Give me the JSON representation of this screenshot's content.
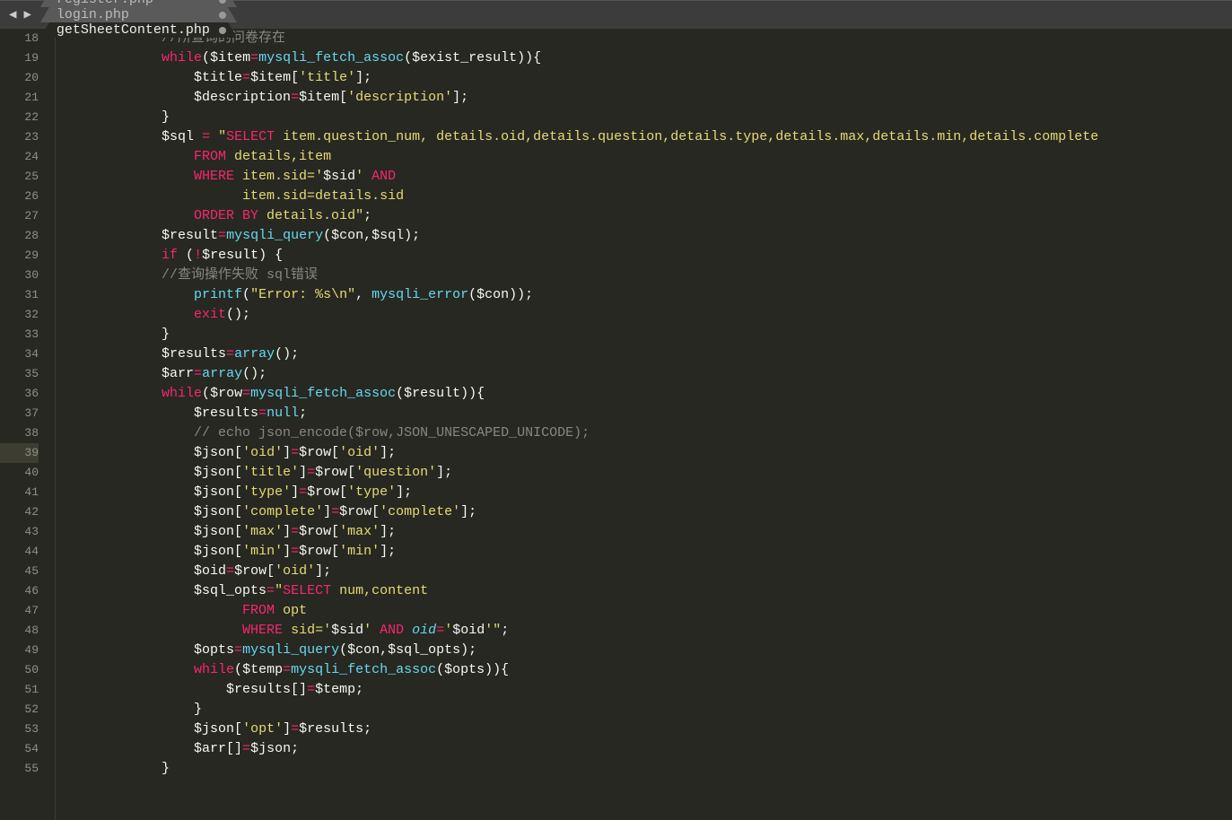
{
  "tabs": [
    {
      "label": "register.php",
      "dirty": true,
      "active": false
    },
    {
      "label": "login.php",
      "dirty": true,
      "active": false
    },
    {
      "label": "getSheetContent.php",
      "dirty": true,
      "active": true
    }
  ],
  "line_start": 18,
  "line_end": 55,
  "highlighted_line": 39,
  "code_lines": [
    {
      "n": 18,
      "tokens": [
        [
          "pn",
          "            "
        ],
        [
          "cmt",
          "//所查询的问卷存在"
        ]
      ]
    },
    {
      "n": 19,
      "tokens": [
        [
          "pn",
          "            "
        ],
        [
          "kw",
          "while"
        ],
        [
          "pn",
          "("
        ],
        [
          "var",
          "$item"
        ],
        [
          "op",
          "="
        ],
        [
          "fn",
          "mysqli_fetch_assoc"
        ],
        [
          "pn",
          "("
        ],
        [
          "var",
          "$exist_result"
        ],
        [
          "pn",
          ")){"
        ]
      ]
    },
    {
      "n": 20,
      "tokens": [
        [
          "pn",
          "                "
        ],
        [
          "var",
          "$title"
        ],
        [
          "op",
          "="
        ],
        [
          "var",
          "$item"
        ],
        [
          "pn",
          "["
        ],
        [
          "str",
          "'title'"
        ],
        [
          "pn",
          "];"
        ]
      ]
    },
    {
      "n": 21,
      "tokens": [
        [
          "pn",
          "                "
        ],
        [
          "var",
          "$description"
        ],
        [
          "op",
          "="
        ],
        [
          "var",
          "$item"
        ],
        [
          "pn",
          "["
        ],
        [
          "str",
          "'description'"
        ],
        [
          "pn",
          "];"
        ]
      ]
    },
    {
      "n": 22,
      "tokens": [
        [
          "pn",
          "            }"
        ]
      ]
    },
    {
      "n": 23,
      "tokens": [
        [
          "pn",
          "            "
        ],
        [
          "var",
          "$sql"
        ],
        [
          "pn",
          " "
        ],
        [
          "op",
          "="
        ],
        [
          "pn",
          " "
        ],
        [
          "str",
          "\""
        ],
        [
          "kw",
          "SELECT"
        ],
        [
          "str",
          " item.question_num, details.oid,details.question,details.type,details.max,details.min,details.complete"
        ]
      ]
    },
    {
      "n": 24,
      "tokens": [
        [
          "pn",
          "                "
        ],
        [
          "kw",
          "FROM"
        ],
        [
          "str",
          " details,item"
        ]
      ]
    },
    {
      "n": 25,
      "tokens": [
        [
          "pn",
          "                "
        ],
        [
          "kw",
          "WHERE"
        ],
        [
          "str",
          " item.sid="
        ],
        [
          "str",
          "'"
        ],
        [
          "var",
          "$sid"
        ],
        [
          "str",
          "'"
        ],
        [
          "str",
          " "
        ],
        [
          "kw",
          "AND"
        ]
      ]
    },
    {
      "n": 26,
      "tokens": [
        [
          "pn",
          "                      "
        ],
        [
          "str",
          "item.sid=details.sid"
        ]
      ]
    },
    {
      "n": 27,
      "tokens": [
        [
          "pn",
          "                "
        ],
        [
          "kw",
          "ORDER BY"
        ],
        [
          "str",
          " details.oid\""
        ],
        [
          "pn",
          ";"
        ]
      ]
    },
    {
      "n": 28,
      "tokens": [
        [
          "pn",
          "            "
        ],
        [
          "var",
          "$result"
        ],
        [
          "op",
          "="
        ],
        [
          "fn",
          "mysqli_query"
        ],
        [
          "pn",
          "("
        ],
        [
          "var",
          "$con"
        ],
        [
          "pn",
          ","
        ],
        [
          "var",
          "$sql"
        ],
        [
          "pn",
          ");"
        ]
      ]
    },
    {
      "n": 29,
      "tokens": [
        [
          "pn",
          "            "
        ],
        [
          "kw",
          "if"
        ],
        [
          "pn",
          " ("
        ],
        [
          "op",
          "!"
        ],
        [
          "var",
          "$result"
        ],
        [
          "pn",
          ") {"
        ]
      ]
    },
    {
      "n": 30,
      "tokens": [
        [
          "pn",
          "            "
        ],
        [
          "cmt",
          "//查询操作失败 sql错误"
        ]
      ]
    },
    {
      "n": 31,
      "tokens": [
        [
          "pn",
          "                "
        ],
        [
          "fn",
          "printf"
        ],
        [
          "pn",
          "("
        ],
        [
          "str",
          "\"Error: %s\\n\""
        ],
        [
          "pn",
          ", "
        ],
        [
          "fn",
          "mysqli_error"
        ],
        [
          "pn",
          "("
        ],
        [
          "var",
          "$con"
        ],
        [
          "pn",
          "));"
        ]
      ]
    },
    {
      "n": 32,
      "tokens": [
        [
          "pn",
          "                "
        ],
        [
          "kw",
          "exit"
        ],
        [
          "pn",
          "();"
        ]
      ]
    },
    {
      "n": 33,
      "tokens": [
        [
          "pn",
          "            }"
        ]
      ]
    },
    {
      "n": 34,
      "tokens": [
        [
          "pn",
          "            "
        ],
        [
          "var",
          "$results"
        ],
        [
          "op",
          "="
        ],
        [
          "fn",
          "array"
        ],
        [
          "pn",
          "();"
        ]
      ]
    },
    {
      "n": 35,
      "tokens": [
        [
          "pn",
          "            "
        ],
        [
          "var",
          "$arr"
        ],
        [
          "op",
          "="
        ],
        [
          "fn",
          "array"
        ],
        [
          "pn",
          "();"
        ]
      ]
    },
    {
      "n": 36,
      "tokens": [
        [
          "pn",
          "            "
        ],
        [
          "kw",
          "while"
        ],
        [
          "pn",
          "("
        ],
        [
          "var",
          "$row"
        ],
        [
          "op",
          "="
        ],
        [
          "fn",
          "mysqli_fetch_assoc"
        ],
        [
          "pn",
          "("
        ],
        [
          "var",
          "$result"
        ],
        [
          "pn",
          ")){"
        ]
      ]
    },
    {
      "n": 37,
      "tokens": [
        [
          "pn",
          "                "
        ],
        [
          "var",
          "$results"
        ],
        [
          "op",
          "="
        ],
        [
          "fn",
          "null"
        ],
        [
          "pn",
          ";"
        ]
      ]
    },
    {
      "n": 38,
      "tokens": [
        [
          "pn",
          "                "
        ],
        [
          "cmt",
          "// echo json_encode($row,JSON_UNESCAPED_UNICODE);"
        ]
      ]
    },
    {
      "n": 39,
      "tokens": [
        [
          "pn",
          "                "
        ],
        [
          "var",
          "$json"
        ],
        [
          "pn",
          "["
        ],
        [
          "str",
          "'oid'"
        ],
        [
          "pn",
          "]"
        ],
        [
          "op",
          "="
        ],
        [
          "var",
          "$row"
        ],
        [
          "pn",
          "["
        ],
        [
          "str",
          "'oid'"
        ],
        [
          "pn",
          "];"
        ]
      ]
    },
    {
      "n": 40,
      "tokens": [
        [
          "pn",
          "                "
        ],
        [
          "var",
          "$json"
        ],
        [
          "pn",
          "["
        ],
        [
          "str",
          "'title'"
        ],
        [
          "pn",
          "]"
        ],
        [
          "op",
          "="
        ],
        [
          "var",
          "$row"
        ],
        [
          "pn",
          "["
        ],
        [
          "str",
          "'question'"
        ],
        [
          "pn",
          "];"
        ]
      ]
    },
    {
      "n": 41,
      "tokens": [
        [
          "pn",
          "                "
        ],
        [
          "var",
          "$json"
        ],
        [
          "pn",
          "["
        ],
        [
          "str",
          "'type'"
        ],
        [
          "pn",
          "]"
        ],
        [
          "op",
          "="
        ],
        [
          "var",
          "$row"
        ],
        [
          "pn",
          "["
        ],
        [
          "str",
          "'type'"
        ],
        [
          "pn",
          "];"
        ]
      ]
    },
    {
      "n": 42,
      "tokens": [
        [
          "pn",
          "                "
        ],
        [
          "var",
          "$json"
        ],
        [
          "pn",
          "["
        ],
        [
          "str",
          "'complete'"
        ],
        [
          "pn",
          "]"
        ],
        [
          "op",
          "="
        ],
        [
          "var",
          "$row"
        ],
        [
          "pn",
          "["
        ],
        [
          "str",
          "'complete'"
        ],
        [
          "pn",
          "];"
        ]
      ]
    },
    {
      "n": 43,
      "tokens": [
        [
          "pn",
          "                "
        ],
        [
          "var",
          "$json"
        ],
        [
          "pn",
          "["
        ],
        [
          "str",
          "'max'"
        ],
        [
          "pn",
          "]"
        ],
        [
          "op",
          "="
        ],
        [
          "var",
          "$row"
        ],
        [
          "pn",
          "["
        ],
        [
          "str",
          "'max'"
        ],
        [
          "pn",
          "];"
        ]
      ]
    },
    {
      "n": 44,
      "tokens": [
        [
          "pn",
          "                "
        ],
        [
          "var",
          "$json"
        ],
        [
          "pn",
          "["
        ],
        [
          "str",
          "'min'"
        ],
        [
          "pn",
          "]"
        ],
        [
          "op",
          "="
        ],
        [
          "var",
          "$row"
        ],
        [
          "pn",
          "["
        ],
        [
          "str",
          "'min'"
        ],
        [
          "pn",
          "];"
        ]
      ]
    },
    {
      "n": 45,
      "tokens": [
        [
          "pn",
          "                "
        ],
        [
          "var",
          "$oid"
        ],
        [
          "op",
          "="
        ],
        [
          "var",
          "$row"
        ],
        [
          "pn",
          "["
        ],
        [
          "str",
          "'oid'"
        ],
        [
          "pn",
          "];"
        ]
      ]
    },
    {
      "n": 46,
      "tokens": [
        [
          "pn",
          "                "
        ],
        [
          "var",
          "$sql_opts"
        ],
        [
          "op",
          "="
        ],
        [
          "str",
          "\""
        ],
        [
          "kw",
          "SELECT"
        ],
        [
          "str",
          " num,content"
        ]
      ]
    },
    {
      "n": 47,
      "tokens": [
        [
          "pn",
          "                      "
        ],
        [
          "kw",
          "FROM"
        ],
        [
          "str",
          " opt"
        ]
      ]
    },
    {
      "n": 48,
      "tokens": [
        [
          "pn",
          "                      "
        ],
        [
          "kw",
          "WHERE"
        ],
        [
          "str",
          " sid="
        ],
        [
          "str",
          "'"
        ],
        [
          "var",
          "$sid"
        ],
        [
          "str",
          "'"
        ],
        [
          "str",
          " "
        ],
        [
          "kw",
          "AND"
        ],
        [
          "str",
          " "
        ],
        [
          "it",
          "oid"
        ],
        [
          "op",
          "="
        ],
        [
          "str",
          "'"
        ],
        [
          "var",
          "$oid"
        ],
        [
          "str",
          "'\""
        ],
        [
          "pn",
          ";"
        ]
      ]
    },
    {
      "n": 49,
      "tokens": [
        [
          "pn",
          "                "
        ],
        [
          "var",
          "$opts"
        ],
        [
          "op",
          "="
        ],
        [
          "fn",
          "mysqli_query"
        ],
        [
          "pn",
          "("
        ],
        [
          "var",
          "$con"
        ],
        [
          "pn",
          ","
        ],
        [
          "var",
          "$sql_opts"
        ],
        [
          "pn",
          ");"
        ]
      ]
    },
    {
      "n": 50,
      "tokens": [
        [
          "pn",
          "                "
        ],
        [
          "kw",
          "while"
        ],
        [
          "pn",
          "("
        ],
        [
          "var",
          "$temp"
        ],
        [
          "op",
          "="
        ],
        [
          "fn",
          "mysqli_fetch_assoc"
        ],
        [
          "pn",
          "("
        ],
        [
          "var",
          "$opts"
        ],
        [
          "pn",
          ")){"
        ]
      ]
    },
    {
      "n": 51,
      "tokens": [
        [
          "pn",
          "                    "
        ],
        [
          "var",
          "$results"
        ],
        [
          "pn",
          "[]"
        ],
        [
          "op",
          "="
        ],
        [
          "var",
          "$temp"
        ],
        [
          "pn",
          ";"
        ]
      ]
    },
    {
      "n": 52,
      "tokens": [
        [
          "pn",
          "                }"
        ]
      ]
    },
    {
      "n": 53,
      "tokens": [
        [
          "pn",
          "                "
        ],
        [
          "var",
          "$json"
        ],
        [
          "pn",
          "["
        ],
        [
          "str",
          "'opt'"
        ],
        [
          "pn",
          "]"
        ],
        [
          "op",
          "="
        ],
        [
          "var",
          "$results"
        ],
        [
          "pn",
          ";"
        ]
      ]
    },
    {
      "n": 54,
      "tokens": [
        [
          "pn",
          "                "
        ],
        [
          "var",
          "$arr"
        ],
        [
          "pn",
          "[]"
        ],
        [
          "op",
          "="
        ],
        [
          "var",
          "$json"
        ],
        [
          "pn",
          ";"
        ]
      ]
    },
    {
      "n": 55,
      "tokens": [
        [
          "pn",
          "            }"
        ]
      ]
    }
  ]
}
